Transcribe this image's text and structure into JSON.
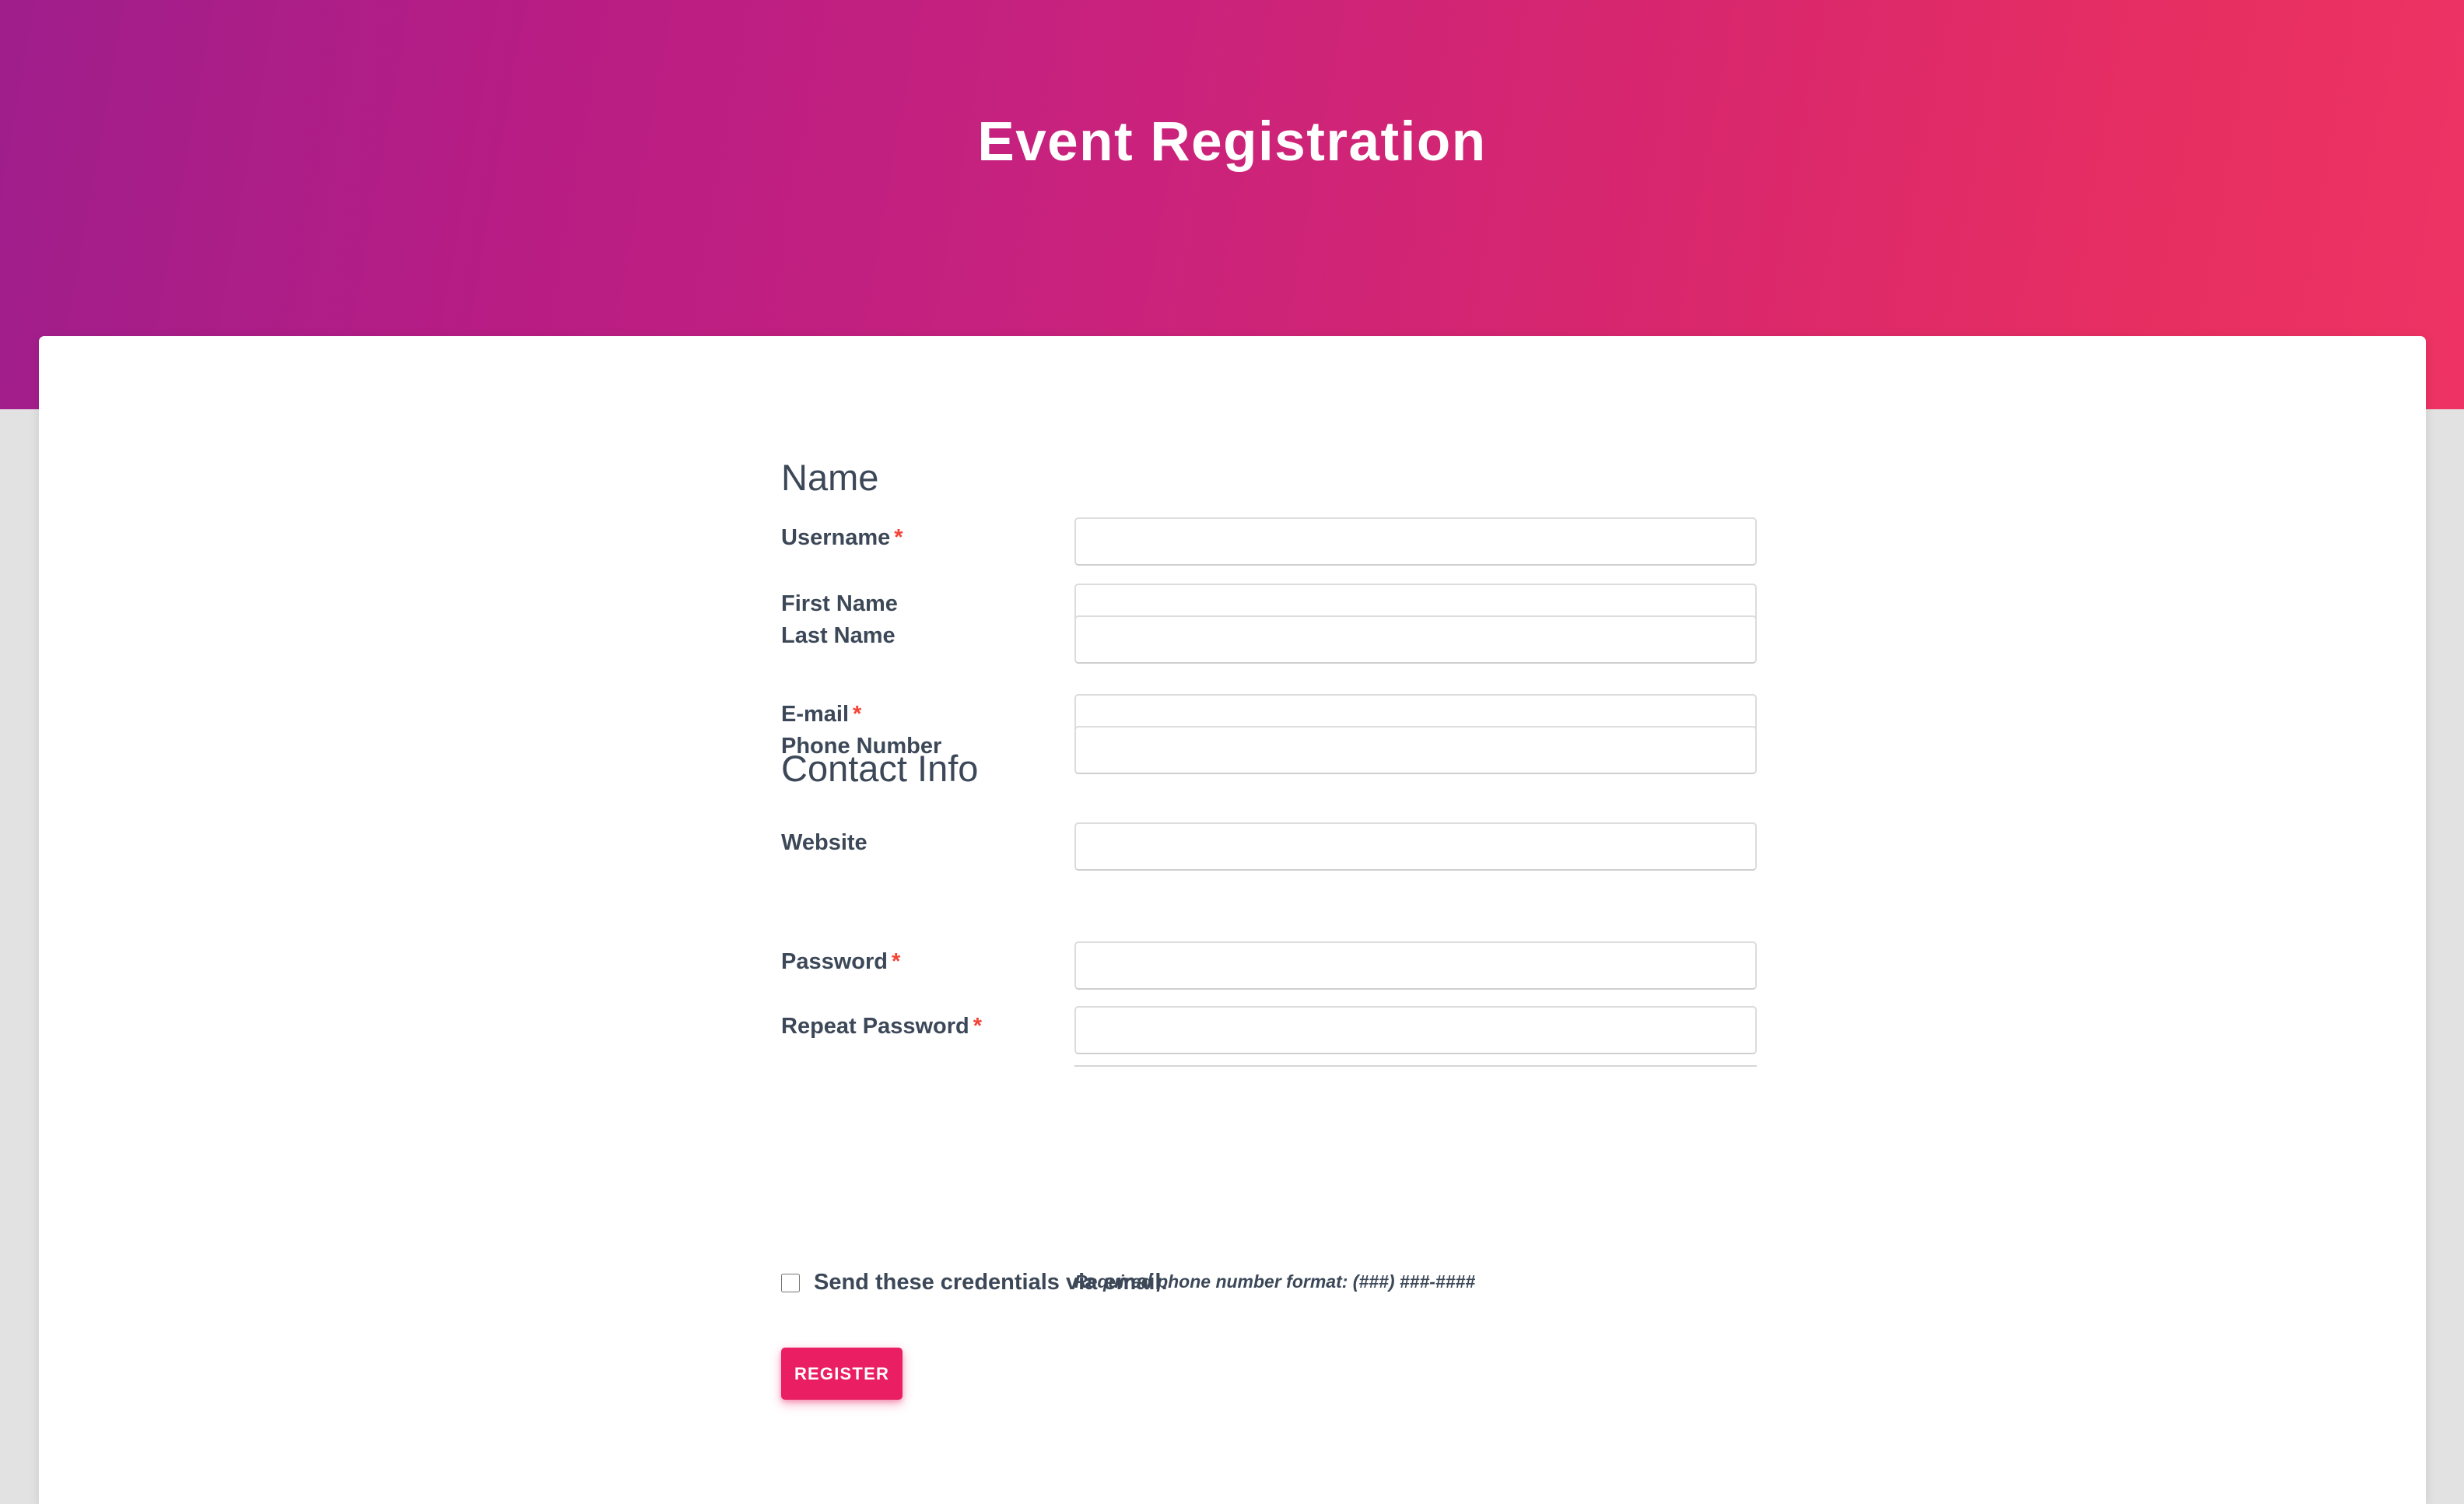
{
  "page": {
    "title": "Event Registration",
    "background_color": "#e2e2e2"
  },
  "header": {
    "title": "Event Registration",
    "gradient_start": "#9f1e8c",
    "gradient_end": "#ee3364",
    "text_color": "#ffffff"
  },
  "form": {
    "sections": [
      {
        "heading": "Name",
        "fields": [
          {
            "label": "Username",
            "required": true,
            "required_mark": "*",
            "value": "",
            "placeholder": ""
          },
          {
            "label": "First Name",
            "required": false,
            "required_mark": "",
            "value": "",
            "placeholder": ""
          },
          {
            "label": "Last Name",
            "required": false,
            "required_mark": "",
            "value": "",
            "placeholder": ""
          }
        ]
      },
      {
        "heading": "Contact Info",
        "fields": [
          {
            "label": "E-mail",
            "required": true,
            "required_mark": "*",
            "value": "",
            "placeholder": ""
          },
          {
            "label": "Phone Number",
            "required": false,
            "required_mark": "",
            "value": "",
            "placeholder": ""
          },
          {
            "label": "Website",
            "required": false,
            "required_mark": "",
            "value": "",
            "placeholder": ""
          }
        ]
      },
      {
        "heading": "",
        "fields": [
          {
            "label": "Password",
            "required": true,
            "required_mark": "*",
            "value": "",
            "placeholder": ""
          },
          {
            "label": "Repeat Password",
            "required": true,
            "required_mark": "*",
            "value": "",
            "placeholder": ""
          }
        ]
      }
    ],
    "help_texts": {
      "phone_format": "Required phone number format: (###) ###-####"
    },
    "checkbox": {
      "label": "Send these credentials via email.",
      "checked": false
    },
    "submit": {
      "label": "Register",
      "background_color": "#e91e63",
      "text_color": "#ffffff"
    },
    "colors": {
      "label": "#3c4858",
      "required_asterisk": "#f44336",
      "input_border": "#dcdcdc",
      "divider": "#d6d6d6"
    }
  }
}
